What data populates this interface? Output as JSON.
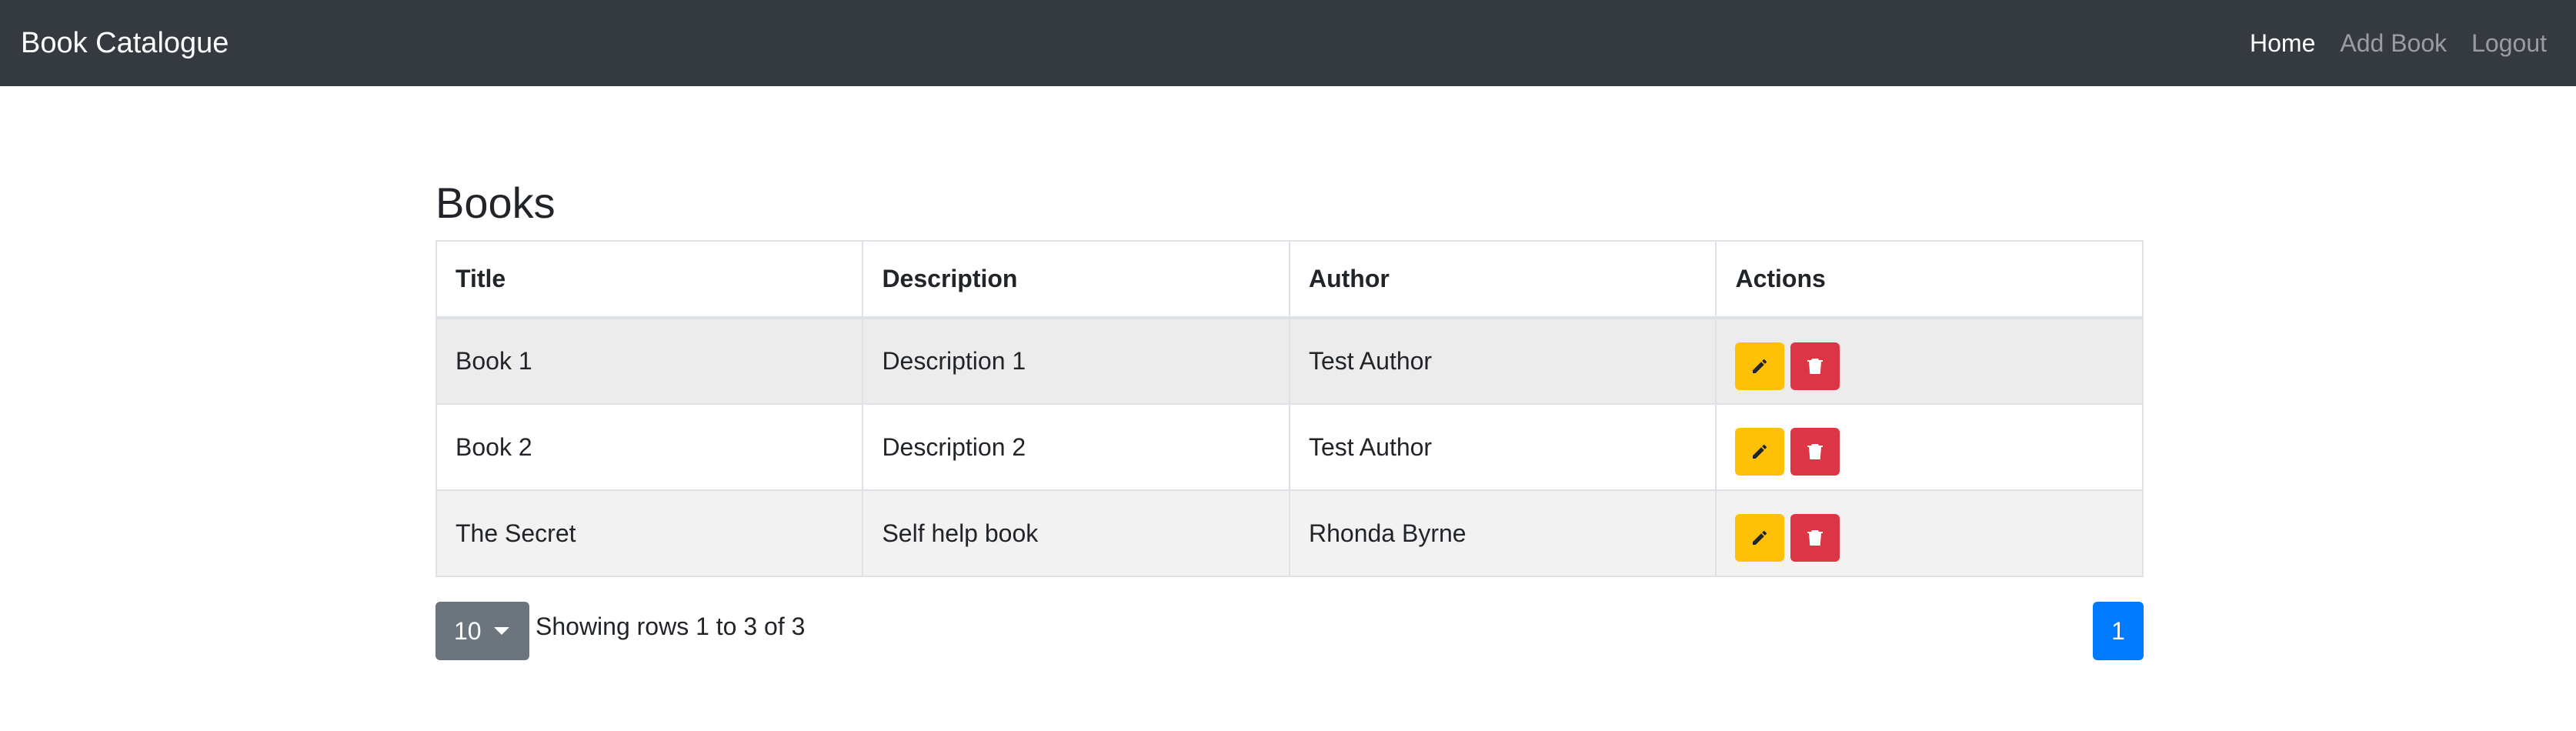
{
  "navbar": {
    "brand": "Book Catalogue",
    "links": [
      {
        "label": "Home",
        "active": true
      },
      {
        "label": "Add Book",
        "active": false
      },
      {
        "label": "Logout",
        "active": false
      }
    ]
  },
  "main": {
    "title": "Books",
    "table": {
      "headers": [
        "Title",
        "Description",
        "Author",
        "Actions"
      ],
      "rows": [
        {
          "title": "Book 1",
          "description": "Description 1",
          "author": "Test Author"
        },
        {
          "title": "Book 2",
          "description": "Description 2",
          "author": "Test Author"
        },
        {
          "title": "The Secret",
          "description": "Self help book",
          "author": "Rhonda Byrne"
        }
      ],
      "row_actions": [
        "edit-icon",
        "delete-icon"
      ]
    },
    "pagination": {
      "page_size": "10",
      "rows_info": "Showing rows 1 to 3 of 3",
      "current_page": "1"
    }
  },
  "colors": {
    "navbar": "#343a40",
    "edit": "#ffc107",
    "delete": "#dc3545",
    "page_size": "#6c757d",
    "primary": "#007bff"
  }
}
